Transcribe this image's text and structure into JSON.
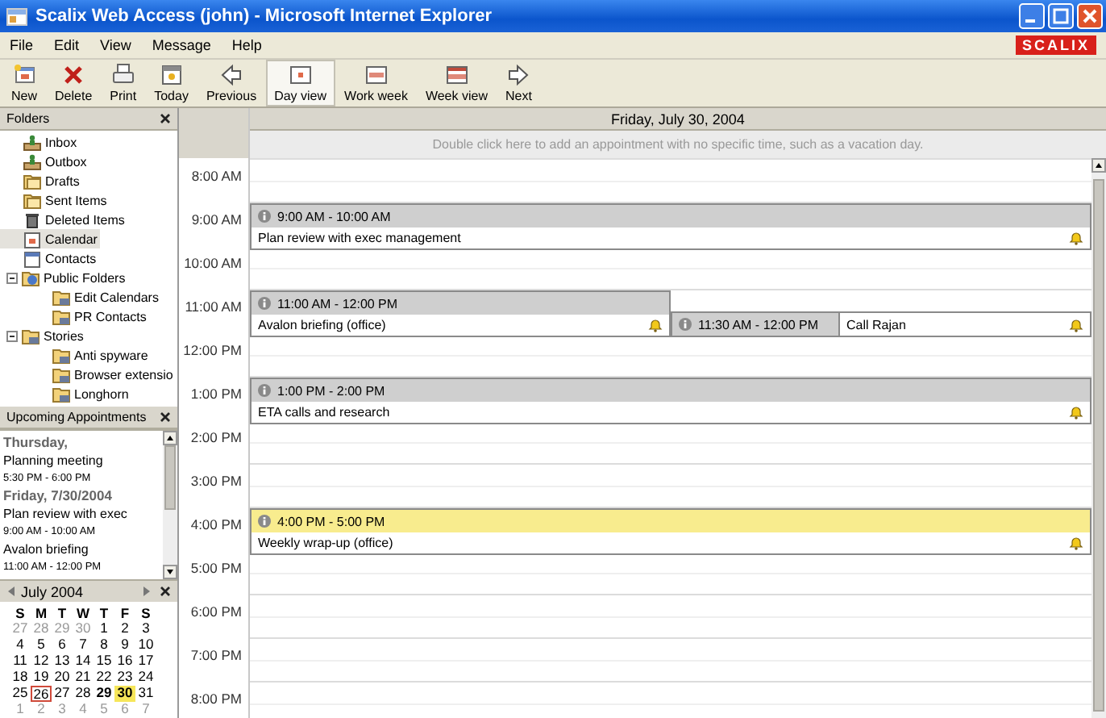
{
  "window": {
    "title": "Scalix Web Access (john) - Microsoft Internet Explorer"
  },
  "menu": [
    "File",
    "Edit",
    "View",
    "Message",
    "Help"
  ],
  "logo": "SCALIX",
  "toolbar": [
    {
      "label": "New",
      "kind": "new",
      "selected": false
    },
    {
      "label": "Delete",
      "kind": "delete",
      "selected": false
    },
    {
      "label": "Print",
      "kind": "print",
      "selected": false
    },
    {
      "label": "Today",
      "kind": "today",
      "selected": false
    },
    {
      "label": "Previous",
      "kind": "previous",
      "selected": false
    },
    {
      "label": "Day view",
      "kind": "day",
      "selected": true
    },
    {
      "label": "Work week",
      "kind": "workweek",
      "selected": false
    },
    {
      "label": "Week view",
      "kind": "week",
      "selected": false
    },
    {
      "label": "Next",
      "kind": "next",
      "selected": false
    }
  ],
  "folders": {
    "title": "Folders",
    "items": [
      {
        "label": "Inbox",
        "kind": "inbox",
        "selected": false
      },
      {
        "label": "Outbox",
        "kind": "inbox",
        "selected": false
      },
      {
        "label": "Drafts",
        "kind": "folder",
        "selected": false
      },
      {
        "label": "Sent Items",
        "kind": "folder",
        "selected": false
      },
      {
        "label": "Deleted Items",
        "kind": "trash",
        "selected": false
      },
      {
        "label": "Calendar",
        "kind": "calendar",
        "selected": true
      },
      {
        "label": "Contacts",
        "kind": "contacts",
        "selected": false
      },
      {
        "label": "Public Folders",
        "kind": "public",
        "selected": false,
        "expanded": true,
        "children": [
          {
            "label": "Edit Calendars",
            "kind": "shared",
            "selected": false
          },
          {
            "label": "PR Contacts",
            "kind": "shared",
            "selected": false
          }
        ]
      },
      {
        "label": "Stories",
        "kind": "shared",
        "selected": false,
        "expanded": true,
        "children": [
          {
            "label": "Anti spyware",
            "kind": "shared",
            "selected": false
          },
          {
            "label": "Browser extensio",
            "kind": "shared",
            "selected": false
          },
          {
            "label": "Longhorn",
            "kind": "shared",
            "selected": false
          }
        ]
      }
    ]
  },
  "upcoming": {
    "title": "Upcoming Appointments",
    "items": [
      {
        "kind": "day",
        "text": "Thursday,"
      },
      {
        "kind": "title",
        "text": "Planning meeting"
      },
      {
        "kind": "time",
        "text": "5:30 PM - 6:00 PM"
      },
      {
        "kind": "day",
        "text": "Friday, 7/30/2004"
      },
      {
        "kind": "title",
        "text": "Plan review with exec"
      },
      {
        "kind": "time",
        "text": "9:00 AM - 10:00 AM"
      },
      {
        "kind": "title",
        "text": "Avalon briefing"
      },
      {
        "kind": "time",
        "text": "11:00 AM - 12:00 PM"
      }
    ]
  },
  "mini_calendar": {
    "month": "July 2004",
    "weekdays": [
      "S",
      "M",
      "T",
      "W",
      "T",
      "F",
      "S"
    ],
    "weeks": [
      [
        {
          "d": "27",
          "muted": true,
          "today": false,
          "selected": false,
          "bold": false
        },
        {
          "d": "28",
          "muted": true,
          "today": false,
          "selected": false,
          "bold": false
        },
        {
          "d": "29",
          "muted": true,
          "today": false,
          "selected": false,
          "bold": false
        },
        {
          "d": "30",
          "muted": true,
          "today": false,
          "selected": false,
          "bold": false
        },
        {
          "d": "1",
          "muted": false,
          "today": false,
          "selected": false,
          "bold": false
        },
        {
          "d": "2",
          "muted": false,
          "today": false,
          "selected": false,
          "bold": false
        },
        {
          "d": "3",
          "muted": false,
          "today": false,
          "selected": false,
          "bold": false
        }
      ],
      [
        {
          "d": "4",
          "muted": false,
          "today": false,
          "selected": false,
          "bold": false
        },
        {
          "d": "5",
          "muted": false,
          "today": false,
          "selected": false,
          "bold": false
        },
        {
          "d": "6",
          "muted": false,
          "today": false,
          "selected": false,
          "bold": false
        },
        {
          "d": "7",
          "muted": false,
          "today": false,
          "selected": false,
          "bold": false
        },
        {
          "d": "8",
          "muted": false,
          "today": false,
          "selected": false,
          "bold": false
        },
        {
          "d": "9",
          "muted": false,
          "today": false,
          "selected": false,
          "bold": false
        },
        {
          "d": "10",
          "muted": false,
          "today": false,
          "selected": false,
          "bold": false
        }
      ],
      [
        {
          "d": "11",
          "muted": false,
          "today": false,
          "selected": false,
          "bold": false
        },
        {
          "d": "12",
          "muted": false,
          "today": false,
          "selected": false,
          "bold": false
        },
        {
          "d": "13",
          "muted": false,
          "today": false,
          "selected": false,
          "bold": false
        },
        {
          "d": "14",
          "muted": false,
          "today": false,
          "selected": false,
          "bold": false
        },
        {
          "d": "15",
          "muted": false,
          "today": false,
          "selected": false,
          "bold": false
        },
        {
          "d": "16",
          "muted": false,
          "today": false,
          "selected": false,
          "bold": false
        },
        {
          "d": "17",
          "muted": false,
          "today": false,
          "selected": false,
          "bold": false
        }
      ],
      [
        {
          "d": "18",
          "muted": false,
          "today": false,
          "selected": false,
          "bold": false
        },
        {
          "d": "19",
          "muted": false,
          "today": false,
          "selected": false,
          "bold": false
        },
        {
          "d": "20",
          "muted": false,
          "today": false,
          "selected": false,
          "bold": false
        },
        {
          "d": "21",
          "muted": false,
          "today": false,
          "selected": false,
          "bold": false
        },
        {
          "d": "22",
          "muted": false,
          "today": false,
          "selected": false,
          "bold": false
        },
        {
          "d": "23",
          "muted": false,
          "today": false,
          "selected": false,
          "bold": false
        },
        {
          "d": "24",
          "muted": false,
          "today": false,
          "selected": false,
          "bold": false
        }
      ],
      [
        {
          "d": "25",
          "muted": false,
          "today": false,
          "selected": false,
          "bold": false
        },
        {
          "d": "26",
          "muted": false,
          "today": true,
          "selected": false,
          "bold": false
        },
        {
          "d": "27",
          "muted": false,
          "today": false,
          "selected": false,
          "bold": false
        },
        {
          "d": "28",
          "muted": false,
          "today": false,
          "selected": false,
          "bold": false
        },
        {
          "d": "29",
          "muted": false,
          "today": false,
          "selected": false,
          "bold": true
        },
        {
          "d": "30",
          "muted": false,
          "today": false,
          "selected": true,
          "bold": true
        },
        {
          "d": "31",
          "muted": false,
          "today": false,
          "selected": false,
          "bold": false
        }
      ],
      [
        {
          "d": "1",
          "muted": true,
          "today": false,
          "selected": false,
          "bold": false
        },
        {
          "d": "2",
          "muted": true,
          "today": false,
          "selected": false,
          "bold": false
        },
        {
          "d": "3",
          "muted": true,
          "today": false,
          "selected": false,
          "bold": false
        },
        {
          "d": "4",
          "muted": true,
          "today": false,
          "selected": false,
          "bold": false
        },
        {
          "d": "5",
          "muted": true,
          "today": false,
          "selected": false,
          "bold": false
        },
        {
          "d": "6",
          "muted": true,
          "today": false,
          "selected": false,
          "bold": false
        },
        {
          "d": "7",
          "muted": true,
          "today": false,
          "selected": false,
          "bold": false
        }
      ]
    ]
  },
  "day_view": {
    "date": "Friday, July 30, 2004",
    "all_day_hint": "Double click here to add an appointment with no specific time, such as a vacation day.",
    "hours": [
      {
        "label": "8:00 AM"
      },
      {
        "label": "9:00 AM",
        "appointments": [
          {
            "kind": "full",
            "time": "9:00 AM - 10:00 AM",
            "title": "Plan review with exec management",
            "highlighted": false,
            "reminder": true
          }
        ]
      },
      {
        "label": "10:00 AM"
      },
      {
        "label": "11:00 AM",
        "appointments": [
          {
            "kind": "full",
            "time": "11:00 AM - 12:00 PM",
            "title": "Avalon briefing (office)",
            "highlighted": false,
            "reminder": true
          },
          {
            "kind": "half",
            "time": "11:30 AM - 12:00 PM",
            "title": "Call Rajan",
            "highlighted": false,
            "reminder": true
          }
        ]
      },
      {
        "label": "12:00 PM"
      },
      {
        "label": "1:00 PM",
        "appointments": [
          {
            "kind": "full",
            "time": "1:00 PM - 2:00 PM",
            "title": "ETA calls and research",
            "highlighted": false,
            "reminder": true
          }
        ]
      },
      {
        "label": "2:00 PM"
      },
      {
        "label": "3:00 PM"
      },
      {
        "label": "4:00 PM",
        "appointments": [
          {
            "kind": "full",
            "time": "4:00 PM - 5:00 PM",
            "title": "Weekly wrap-up (office)",
            "highlighted": true,
            "reminder": true
          }
        ]
      },
      {
        "label": "5:00 PM"
      },
      {
        "label": "6:00 PM"
      },
      {
        "label": "7:00 PM"
      },
      {
        "label": "8:00 PM"
      }
    ]
  }
}
